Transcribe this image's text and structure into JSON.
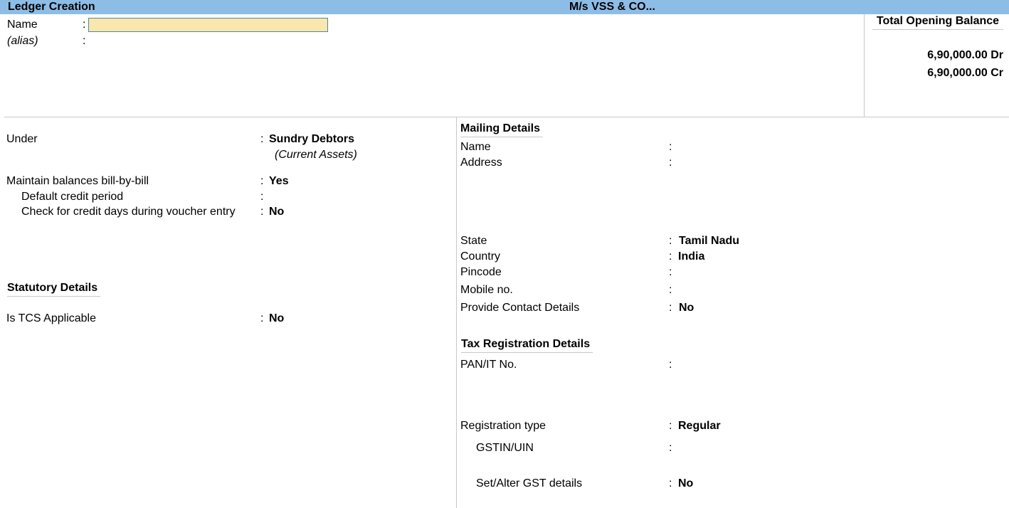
{
  "titlebar": {
    "title": "Ledger Creation",
    "company": "M/s VSS & CO..."
  },
  "header": {
    "name_label": "Name",
    "name_value": "",
    "alias_label": "(alias)",
    "separator": ":"
  },
  "opening_balance": {
    "title": "Total Opening Balance",
    "debit": "6,90,000.00 Dr",
    "credit": "6,90,000.00 Cr"
  },
  "left": {
    "under_label": "Under",
    "under_value": "Sundry Debtors",
    "under_parent": "(Current Assets)",
    "bill_by_bill_label": "Maintain balances bill-by-bill",
    "bill_by_bill_value": "Yes",
    "credit_period_label": "Default credit period",
    "credit_period_value": "",
    "check_credit_label": "Check for credit days during voucher entry",
    "check_credit_value": "No",
    "statutory_title": "Statutory Details",
    "tcs_label": "Is TCS Applicable",
    "tcs_value": "No"
  },
  "mailing": {
    "title": "Mailing Details",
    "name_label": "Name",
    "name_value": "",
    "address_label": "Address",
    "address_value": "",
    "state_label": "State",
    "state_value": "Tamil Nadu",
    "country_label": "Country",
    "country_value": "India",
    "pincode_label": "Pincode",
    "pincode_value": "",
    "mobile_label": "Mobile no.",
    "mobile_value": "",
    "contact_label": "Provide Contact Details",
    "contact_value": "No"
  },
  "tax": {
    "title": "Tax Registration Details",
    "pan_label": "PAN/IT No.",
    "pan_value": "",
    "reg_type_label": "Registration type",
    "reg_type_value": "Regular",
    "gstin_label": "GSTIN/UIN",
    "gstin_value": "",
    "gst_details_label": "Set/Alter GST details",
    "gst_details_value": "No"
  }
}
